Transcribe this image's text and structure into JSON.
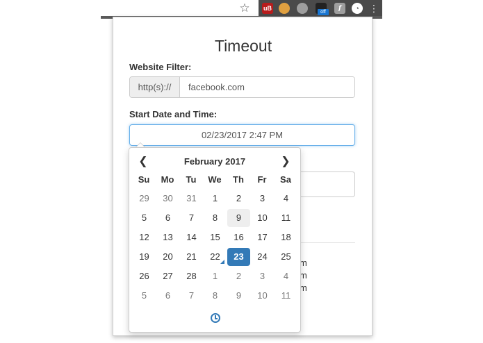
{
  "browser": {
    "star_icon": "star-outline-icon",
    "extensions": [
      {
        "name": "ublock-icon",
        "glyph": "uB"
      },
      {
        "name": "cookie-icon",
        "glyph": ""
      },
      {
        "name": "grey-circle-icon",
        "glyph": ""
      },
      {
        "name": "camera-icon",
        "glyph": "",
        "badge": "off"
      },
      {
        "name": "font-icon",
        "glyph": "f"
      },
      {
        "name": "timeout-extension-icon",
        "glyph": ""
      }
    ],
    "menu_icon": "kebab-menu-icon"
  },
  "popup": {
    "title": "Timeout",
    "website_filter_label": "Website Filter:",
    "protocol_addon": "http(s)://",
    "website_filter_value": "facebook.com",
    "start_label": "Start Date and Time:",
    "start_value": "02/23/2017 2:47 PM",
    "peek_rows": [
      "m",
      "m",
      "m"
    ]
  },
  "datepicker": {
    "month_title": "February 2017",
    "prev_icon": "chevron-left-icon",
    "next_icon": "chevron-right-icon",
    "days_of_week": [
      "Su",
      "Mo",
      "Tu",
      "We",
      "Th",
      "Fr",
      "Sa"
    ],
    "weeks": [
      [
        {
          "d": "29",
          "old": true
        },
        {
          "d": "30",
          "old": true
        },
        {
          "d": "31",
          "old": true
        },
        {
          "d": "1"
        },
        {
          "d": "2"
        },
        {
          "d": "3"
        },
        {
          "d": "4"
        }
      ],
      [
        {
          "d": "5"
        },
        {
          "d": "6"
        },
        {
          "d": "7"
        },
        {
          "d": "8"
        },
        {
          "d": "9",
          "today": true
        },
        {
          "d": "10"
        },
        {
          "d": "11"
        }
      ],
      [
        {
          "d": "12"
        },
        {
          "d": "13"
        },
        {
          "d": "14"
        },
        {
          "d": "15"
        },
        {
          "d": "16"
        },
        {
          "d": "17"
        },
        {
          "d": "18"
        }
      ],
      [
        {
          "d": "19"
        },
        {
          "d": "20"
        },
        {
          "d": "21"
        },
        {
          "d": "22",
          "mark": true
        },
        {
          "d": "23",
          "active": true
        },
        {
          "d": "24"
        },
        {
          "d": "25"
        }
      ],
      [
        {
          "d": "26"
        },
        {
          "d": "27"
        },
        {
          "d": "28"
        },
        {
          "d": "1",
          "old": true
        },
        {
          "d": "2",
          "old": true
        },
        {
          "d": "3",
          "old": true
        },
        {
          "d": "4",
          "old": true
        }
      ],
      [
        {
          "d": "5",
          "old": true
        },
        {
          "d": "6",
          "old": true
        },
        {
          "d": "7",
          "old": true
        },
        {
          "d": "8",
          "old": true
        },
        {
          "d": "9",
          "old": true
        },
        {
          "d": "10",
          "old": true
        },
        {
          "d": "11",
          "old": true
        }
      ]
    ],
    "time_toggle_icon": "clock-icon",
    "accent_color": "#337ab7"
  }
}
